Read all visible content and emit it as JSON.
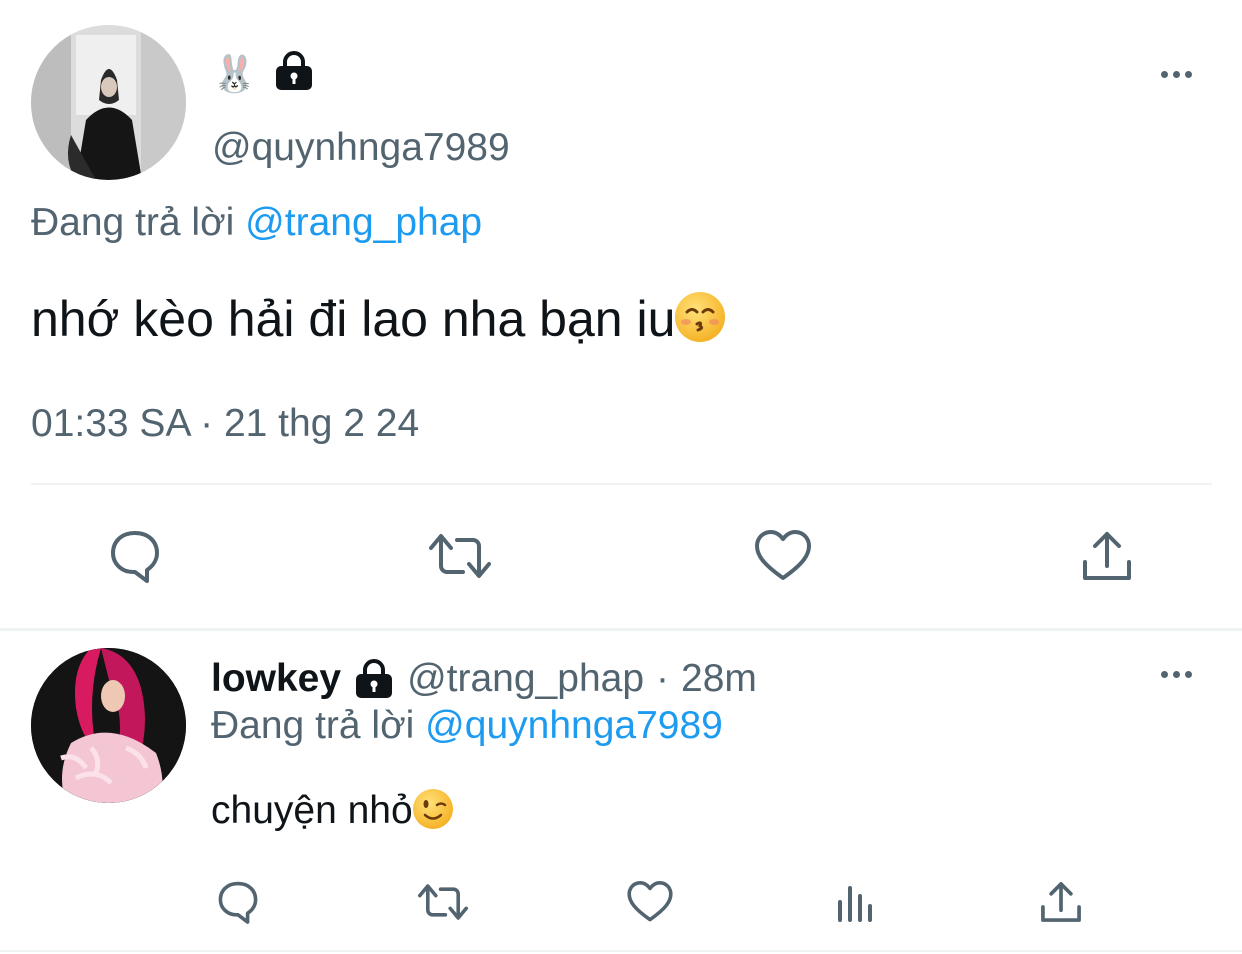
{
  "main_tweet": {
    "display_name_emoji": "🐰",
    "handle": "@quynhnga7989",
    "reply_prefix": "Đang trả lời",
    "reply_to": "@trang_phap",
    "text": "nhớ kèo hải đi lao nha bạn iu",
    "text_emoji": "😚",
    "timestamp": "01:33 SA · 21 thg 2 24",
    "icons": {
      "more": "more-dots-icon",
      "lock": "lock-icon",
      "reply": "reply-icon",
      "retweet": "retweet-icon",
      "like": "heart-icon",
      "share": "share-icon"
    }
  },
  "reply_tweet": {
    "display_name": "lowkey",
    "handle": "@trang_phap",
    "separator": "·",
    "time": "28m",
    "reply_prefix": "Đang trả lời",
    "reply_to": "@quynhnga7989",
    "text": "chuyện nhỏ",
    "text_emoji": "😉",
    "icons": {
      "more": "more-dots-icon",
      "lock": "lock-icon",
      "reply": "reply-icon",
      "retweet": "retweet-icon",
      "like": "heart-icon",
      "views": "views-chart-icon",
      "share": "share-icon"
    }
  },
  "colors": {
    "text": "#0f1419",
    "muted": "#536471",
    "link": "#1d9bf0",
    "divider": "#eff3f4"
  }
}
